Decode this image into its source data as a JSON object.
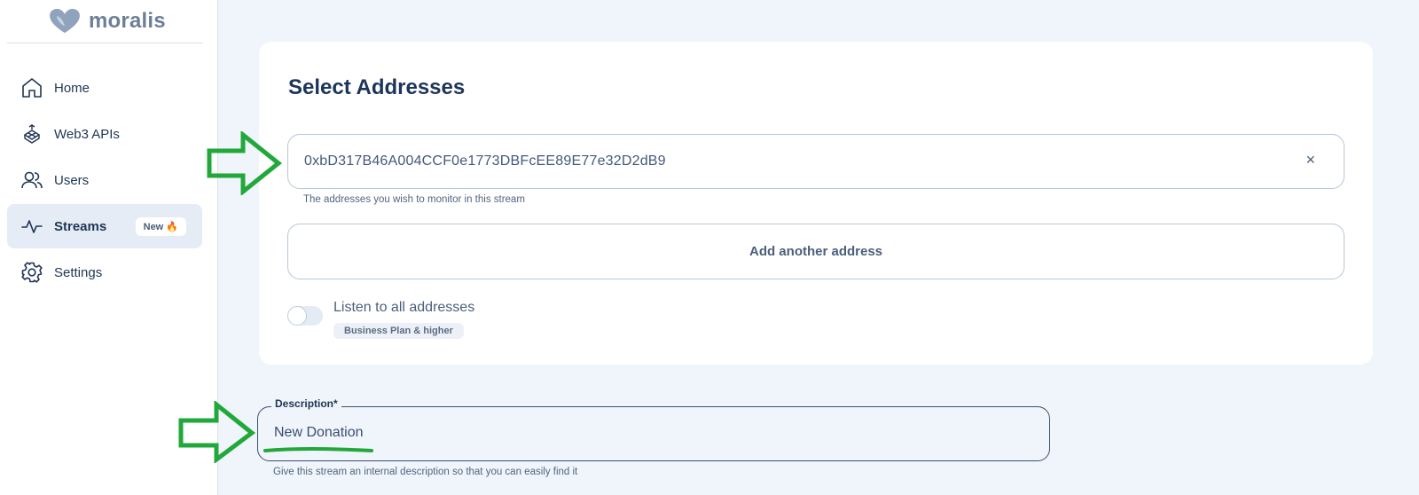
{
  "brand": {
    "name": "moralis",
    "logo_icon": "moralis-heart-logo"
  },
  "sidebar": {
    "items": [
      {
        "label": "Home",
        "icon": "home-icon",
        "active": false
      },
      {
        "label": "Web3 APIs",
        "icon": "web3-apis-icon",
        "active": false
      },
      {
        "label": "Users",
        "icon": "users-icon",
        "active": false
      },
      {
        "label": "Streams",
        "icon": "pulse-icon",
        "active": true,
        "badge": "New 🔥"
      },
      {
        "label": "Settings",
        "icon": "gear-icon",
        "active": false
      }
    ]
  },
  "card": {
    "title": "Select Addresses",
    "address_value": "0xbD317B46A004CCF0e1773DBFcEE89E77e32D2dB9",
    "clear_glyph": "×",
    "address_hint": "The addresses you wish to monitor in this stream",
    "add_button": "Add another address",
    "toggle_label": "Listen to all addresses",
    "toggle_on": false,
    "plan_badge": "Business Plan & higher"
  },
  "description": {
    "legend": "Description*",
    "value": "New Donation",
    "hint": "Give this stream an internal description so that you can easily find it"
  },
  "colors": {
    "background": "#f0f4fb",
    "annotation": "#22a83a",
    "text_primary": "#1c3559"
  }
}
